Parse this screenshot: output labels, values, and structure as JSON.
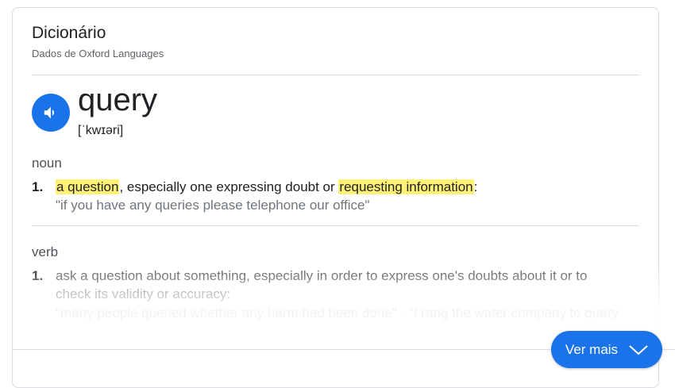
{
  "header": {
    "title": "Dicionário",
    "source": "Dados de Oxford Languages"
  },
  "entry": {
    "word": "query",
    "phonetic": "[ˈkwɪəri]",
    "speaker_icon": "speaker-icon"
  },
  "noun": {
    "pos": "noun",
    "number": "1.",
    "def_part1": "a question",
    "def_part2": ", especially one expressing doubt or ",
    "def_part3": "requesting information",
    "def_part4": ":",
    "example": "\"if you have any queries please telephone our office\""
  },
  "verb": {
    "pos": "verb",
    "number": "1.",
    "def_line1": "ask a question about something, especially in order to express one's doubts about it or to",
    "def_line2": "check its validity or accuracy:",
    "example": "\"many people queried whether any harm had been done\" · \"I rang the water company to query"
  },
  "more_button": {
    "label": "Ver mais",
    "icon": "chevron-down-icon"
  },
  "colors": {
    "accent": "#1a73e8",
    "highlight": "#fff176"
  }
}
